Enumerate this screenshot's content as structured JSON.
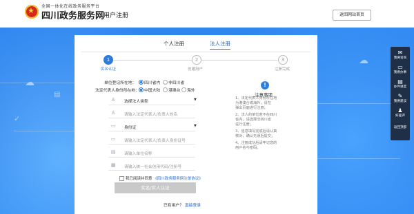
{
  "header": {
    "portal_small": "全国一体化在线政务服务平台",
    "portal_name": "四川政务服务网",
    "page_title": "用户注册",
    "home_button": "返回网站首页"
  },
  "tabs": [
    {
      "label": "个人注册",
      "active": false
    },
    {
      "label": "法人注册",
      "active": true
    }
  ],
  "steps": [
    {
      "num": "1",
      "label": "实名认证",
      "active": true
    },
    {
      "num": "2",
      "label": "创建用户",
      "active": false
    },
    {
      "num": "3",
      "label": "注册完成",
      "active": false
    }
  ],
  "form": {
    "reg_place_label": "单位登记所在地：",
    "reg_place_options": [
      "四川省内",
      "非四川省"
    ],
    "legal_place_label": "法定代表人身份所在地：",
    "legal_place_options": [
      "中国大陆",
      "港澳台",
      "海外"
    ],
    "fields": [
      {
        "icon": "user-icon",
        "glyph": "♙",
        "text": "选择法人类型",
        "dark": true,
        "dropdown": true
      },
      {
        "icon": "user-icon",
        "glyph": "♙",
        "text": "请输入法定代表人/负责人姓名",
        "dark": false,
        "dropdown": false
      },
      {
        "icon": "id-card-icon",
        "glyph": "▭",
        "text": "身份证",
        "dark": true,
        "dropdown": true
      },
      {
        "icon": "id-card-icon",
        "glyph": "▭",
        "text": "请输入法定代表人/负责人身份证号",
        "dark": false,
        "dropdown": false
      },
      {
        "icon": "building-icon",
        "glyph": "▤",
        "text": "请输入单位名称",
        "dark": false,
        "dropdown": false
      },
      {
        "icon": "credit-code-icon",
        "glyph": "▦",
        "text": "请输入统一社会信用代码/注册号",
        "dark": false,
        "dropdown": false
      }
    ],
    "agree_prefix": "我已阅读并同意",
    "agree_link": "《四川政务服务网注册协议》",
    "submit": "实名/实人认证",
    "login_prompt": "已有用户？",
    "login_link": "直接登录"
  },
  "notice": {
    "title": "注意事项",
    "items": [
      "1、法定代表人身份所在地",
      "   为港澳台或海外，请在",
      "   弹出页面进行注册；",
      "2、法人的单位若不在四川",
      "   省内，请选择非四川省",
      "   进行注册；",
      "3、信息填写完成后请认真",
      "   核对，确认无误后提交；",
      "4、注册成功后请牢记您的",
      "   用户名与密码。"
    ]
  },
  "sidebar": [
    {
      "icon": "chat-icon",
      "glyph": "✉",
      "label": "我要咨询"
    },
    {
      "icon": "handle-icon",
      "glyph": "▭",
      "label": "我要办事"
    },
    {
      "icon": "progress-icon",
      "glyph": "▤",
      "label": "办件进度"
    },
    {
      "icon": "suggest-icon",
      "glyph": "✎",
      "label": "我要建议"
    },
    {
      "icon": "evaluate-icon",
      "glyph": "♟",
      "label": "好差评"
    },
    {
      "icon": "top-icon",
      "glyph": "",
      "label": "返回顶部"
    }
  ]
}
